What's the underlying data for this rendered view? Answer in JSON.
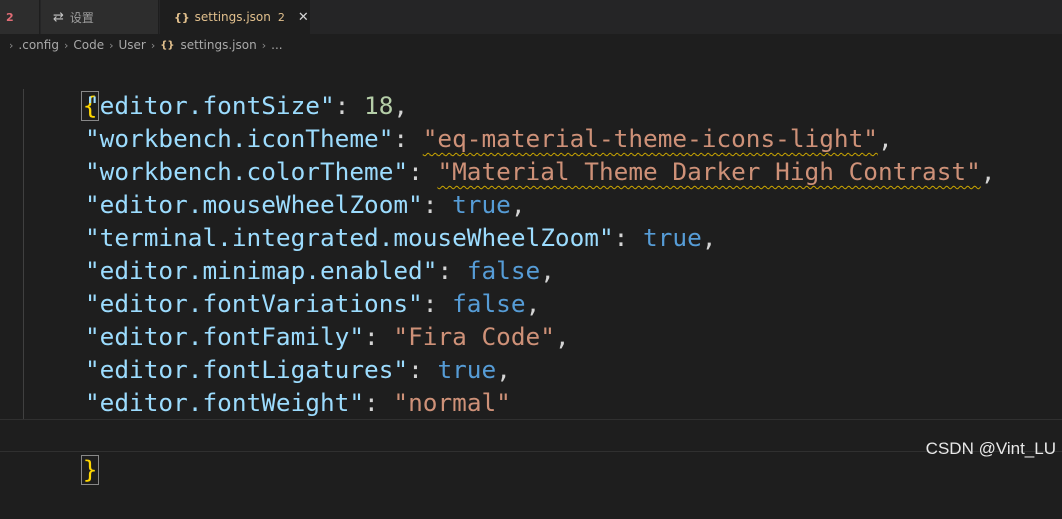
{
  "tabs": [
    {
      "label": "",
      "badge": "2"
    },
    {
      "label": "设置",
      "icon": "settings-icon"
    },
    {
      "label": "settings.json",
      "badge": "2",
      "icon": "json-braces-icon",
      "active": true
    }
  ],
  "breadcrumb": {
    "items": [
      ".config",
      "Code",
      "User",
      "settings.json",
      "..."
    ]
  },
  "editor": {
    "open_brace": "{",
    "close_brace": "}",
    "lines": [
      {
        "key": "\"editor.fontSize\"",
        "value": "18",
        "type": "number",
        "comma": true
      },
      {
        "key": "\"workbench.iconTheme\"",
        "value": "\"eq-material-theme-icons-light\"",
        "type": "string",
        "comma": true,
        "warning": true
      },
      {
        "key": "\"workbench.colorTheme\"",
        "value": "\"Material Theme Darker High Contrast\"",
        "type": "string",
        "comma": true,
        "warning": true
      },
      {
        "key": "\"editor.mouseWheelZoom\"",
        "value": "true",
        "type": "bool",
        "comma": true
      },
      {
        "key": "\"terminal.integrated.mouseWheelZoom\"",
        "value": "true",
        "type": "bool",
        "comma": true
      },
      {
        "key": "\"editor.minimap.enabled\"",
        "value": "false",
        "type": "bool",
        "comma": true
      },
      {
        "key": "\"editor.fontVariations\"",
        "value": "false",
        "type": "bool",
        "comma": true
      },
      {
        "key": "\"editor.fontFamily\"",
        "value": "\"Fira Code\"",
        "type": "string",
        "comma": true
      },
      {
        "key": "\"editor.fontLigatures\"",
        "value": "true",
        "type": "bool",
        "comma": true
      },
      {
        "key": "\"editor.fontWeight\"",
        "value": "\"normal\"",
        "type": "string",
        "comma": false
      }
    ]
  },
  "watermark": "CSDN @Vint_LU",
  "colors": {
    "key": "#9cdcfe",
    "string": "#ce9178",
    "number": "#b5cea8",
    "bool": "#569cd6",
    "warning_squiggle": "#cca700",
    "brace": "#ffd700"
  }
}
